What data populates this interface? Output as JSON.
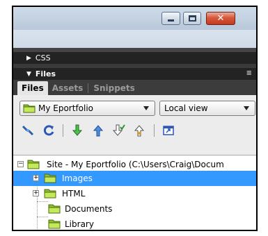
{
  "window": {
    "controls": {
      "minimize_icon": "minimize-icon",
      "restore_icon": "restore-icon",
      "close_icon": "close-icon"
    }
  },
  "panels": {
    "css": {
      "label": "CSS",
      "state": "collapsed"
    },
    "files": {
      "label": "Files",
      "state": "expanded",
      "options_icon": "panel-options-icon"
    }
  },
  "tabs": [
    {
      "label": "Files",
      "active": true
    },
    {
      "label": "Assets",
      "active": false
    },
    {
      "label": "Snippets",
      "active": false
    }
  ],
  "site_select": {
    "value": "My Eportfolio"
  },
  "view_select": {
    "value": "Local view"
  },
  "toolbar": [
    {
      "icon": "connect-icon"
    },
    {
      "icon": "refresh-icon"
    },
    {
      "icon": "get-files-icon"
    },
    {
      "icon": "put-files-icon"
    },
    {
      "icon": "check-out-icon"
    },
    {
      "icon": "check-in-icon"
    },
    {
      "icon": "expand-panel-icon"
    }
  ],
  "tree": {
    "root": {
      "label": "Site - My Eportfolio (C:\\Users\\Craig\\Docum",
      "expanded": true
    },
    "items": [
      {
        "label": "Images",
        "selected": true,
        "expandable": true
      },
      {
        "label": "HTML",
        "selected": false,
        "expandable": true
      },
      {
        "label": "Documents",
        "selected": false,
        "expandable": false
      },
      {
        "label": "Library",
        "selected": false,
        "expandable": false
      }
    ]
  },
  "colors": {
    "selection": "#3399ff",
    "folder": "#b6e04a",
    "panel_header": "#232323",
    "close_button": "#c94a2e"
  }
}
